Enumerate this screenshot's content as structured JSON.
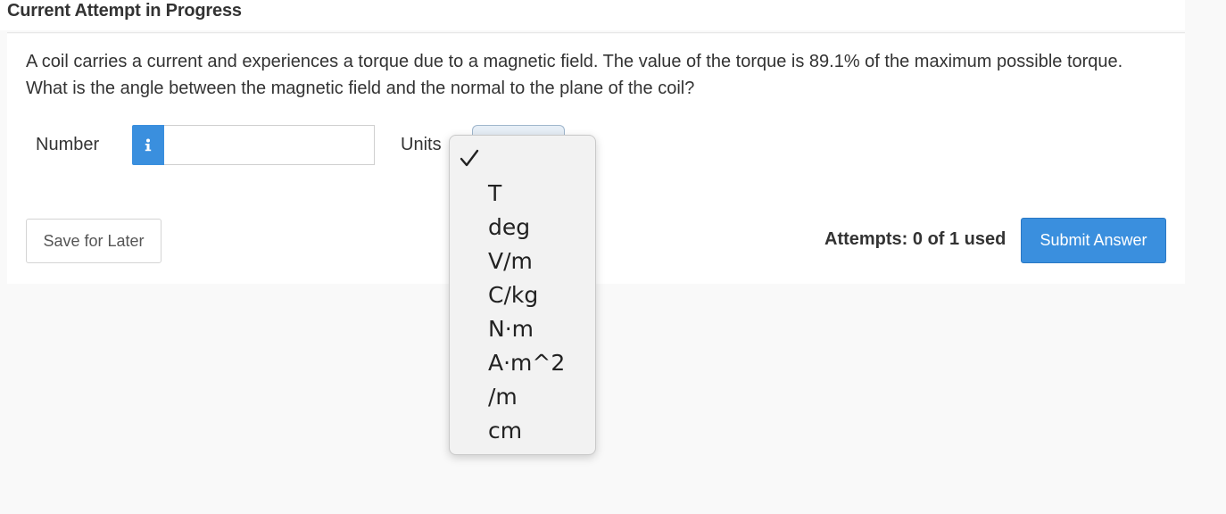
{
  "header": {
    "title": "Current Attempt in Progress"
  },
  "question": {
    "text": "A coil carries a current and experiences a torque due to a magnetic field. The value of the torque is 89.1% of the maximum possible torque. What is the angle between the magnetic field and the normal to the plane of the coil?"
  },
  "answer": {
    "number_label": "Number",
    "info_icon": "info-icon",
    "number_value": "",
    "units_label": "Units",
    "units_selected": ""
  },
  "units_dropdown": {
    "check_icon": "checkmark-icon",
    "options": [
      "T",
      "deg",
      "V/m",
      "C/kg",
      "N·m",
      "A·m^2",
      "/m",
      "cm"
    ]
  },
  "footer": {
    "save_label": "Save for Later",
    "attempts_text": "Attempts: 0 of 1 used",
    "submit_label": "Submit Answer"
  },
  "colors": {
    "accent": "#3a8fde",
    "background": "#f9f9f9"
  }
}
